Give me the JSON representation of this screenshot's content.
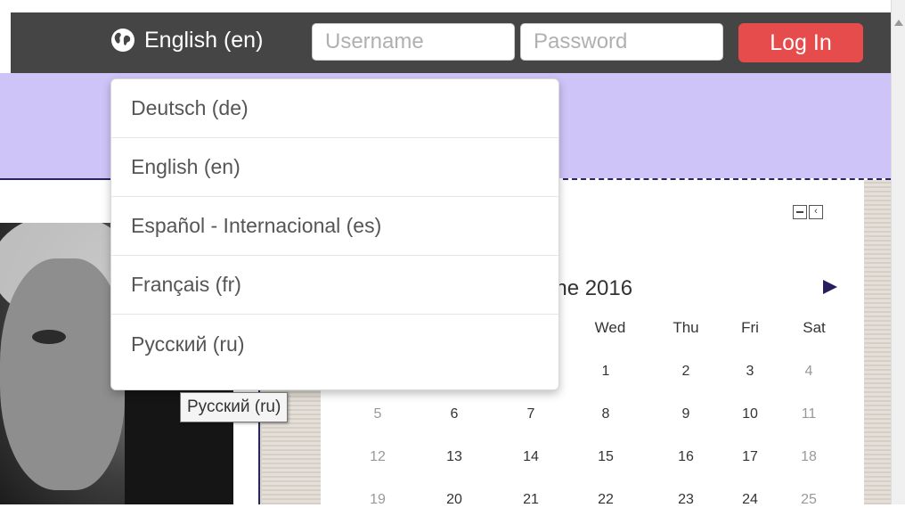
{
  "topbar": {
    "language_label": "English (en)",
    "username_placeholder": "Username",
    "password_placeholder": "Password",
    "login_label": "Log In",
    "login_color": "#e74c4c",
    "bar_color": "#454545"
  },
  "language_menu": {
    "items": [
      {
        "label": "Deutsch (de)"
      },
      {
        "label": "English (en)"
      },
      {
        "label": "Español - Internacional (es)"
      },
      {
        "label": "Français (fr)"
      },
      {
        "label": "Русский (ru)"
      }
    ],
    "tooltip": "Русский (ru)"
  },
  "header": {
    "color": "#cfc4f7"
  },
  "calendar": {
    "month_label": "une 2016",
    "day_headers": [
      "Wed",
      "Thu",
      "Fri",
      "Sat"
    ],
    "rows": [
      [
        "",
        "",
        "1",
        "2",
        "3",
        "4"
      ],
      [
        "5",
        "6",
        "7",
        "8",
        "9",
        "10",
        "11"
      ],
      [
        "12",
        "13",
        "14",
        "15",
        "16",
        "17",
        "18"
      ],
      [
        "19",
        "20",
        "21",
        "22",
        "23",
        "24",
        "25"
      ]
    ]
  },
  "icons": {
    "globe": "globe-icon",
    "minimize": "minimize-icon",
    "dock": "dock-icon",
    "next": "next-month-arrow"
  }
}
